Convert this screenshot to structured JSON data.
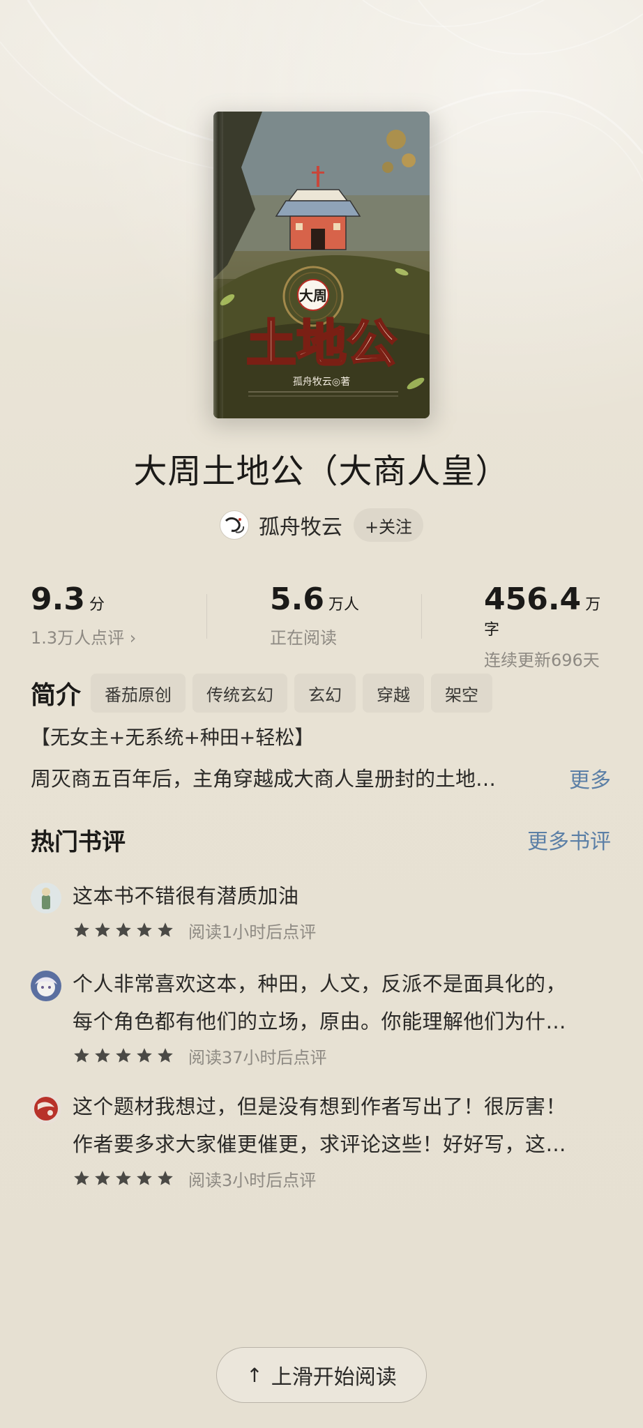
{
  "book": {
    "title": "大周土地公（大商人皇）",
    "cover_title_small": "大周",
    "cover_title_large": "土地公",
    "cover_author": "孤舟牧云◎著"
  },
  "author": {
    "name": "孤舟牧云",
    "follow_label": "+关注"
  },
  "stats": [
    {
      "value": "9.3",
      "unit": "分",
      "label": "1.3万人点评 ›"
    },
    {
      "value": "5.6",
      "unit": "万人",
      "label": "正在阅读"
    },
    {
      "value": "456.4",
      "unit": "万字",
      "label": "连续更新696天"
    }
  ],
  "intro": {
    "heading": "简介",
    "tags": [
      "番茄原创",
      "传统玄幻",
      "玄幻",
      "穿越",
      "架空"
    ],
    "tagline": "【无女主+无系统+种田+轻松】",
    "summary": "周灭商五百年后，主角穿越成大商人皇册封的土地…",
    "more_label": "更多"
  },
  "reviews": {
    "heading": "热门书评",
    "more_label": "更多书评",
    "items": [
      {
        "lines": [
          "这本书不错很有潜质加油"
        ],
        "rating": 5,
        "meta": "阅读1小时后点评"
      },
      {
        "lines": [
          "个人非常喜欢这本，种田，人文，反派不是面具化的，",
          "每个角色都有他们的立场，原由。你能理解他们为什…"
        ],
        "rating": 5,
        "meta": "阅读37小时后点评"
      },
      {
        "lines": [
          "这个题材我想过，但是没有想到作者写出了！很厉害！",
          "作者要多求大家催更催更，求评论这些！好好写，这…"
        ],
        "rating": 5,
        "meta": "阅读3小时后点评"
      }
    ]
  },
  "start_reading_label": "上滑开始阅读",
  "colors": {
    "background": "#e9e3d6",
    "link_blue": "#5b7fa6",
    "star": "#4a4945"
  }
}
